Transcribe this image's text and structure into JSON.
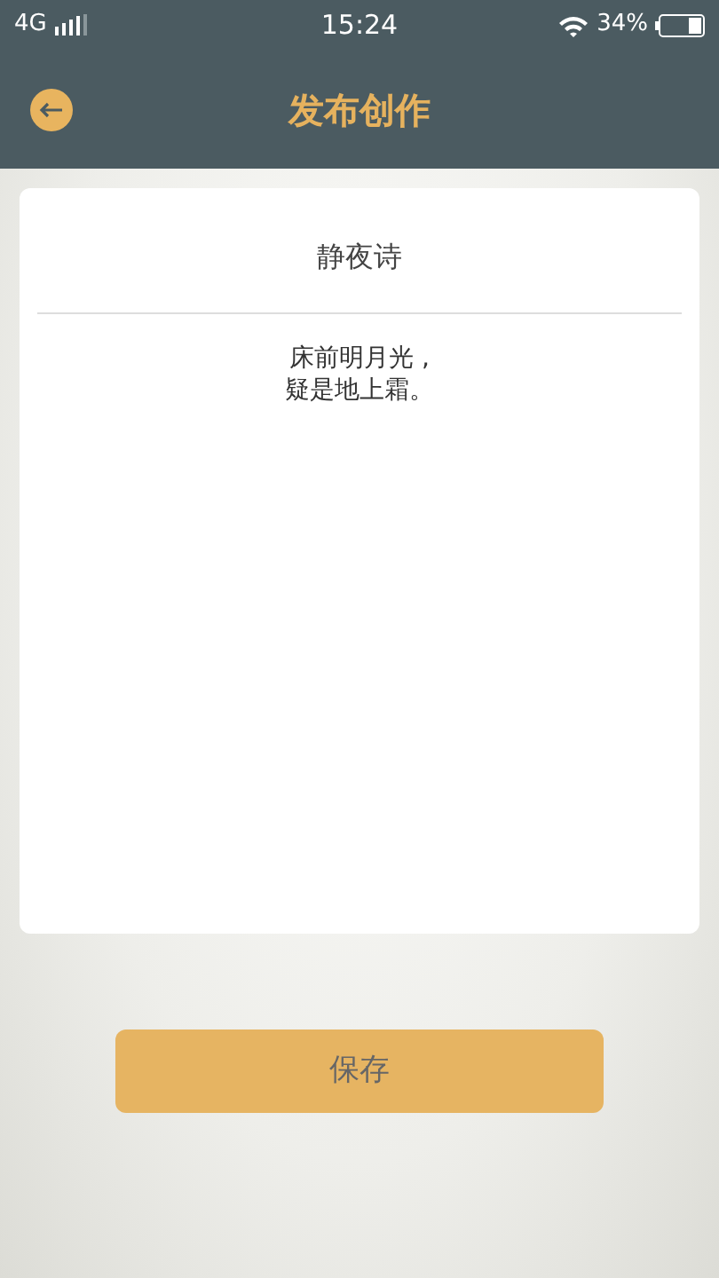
{
  "status_bar": {
    "network": "4G",
    "time": "15:24",
    "battery": "34%"
  },
  "header": {
    "title": "发布创作"
  },
  "poem": {
    "title": "静夜诗",
    "lines": [
      "床前明月光 ,",
      "疑是地上霜。"
    ]
  },
  "buttons": [
    "保存"
  ]
}
